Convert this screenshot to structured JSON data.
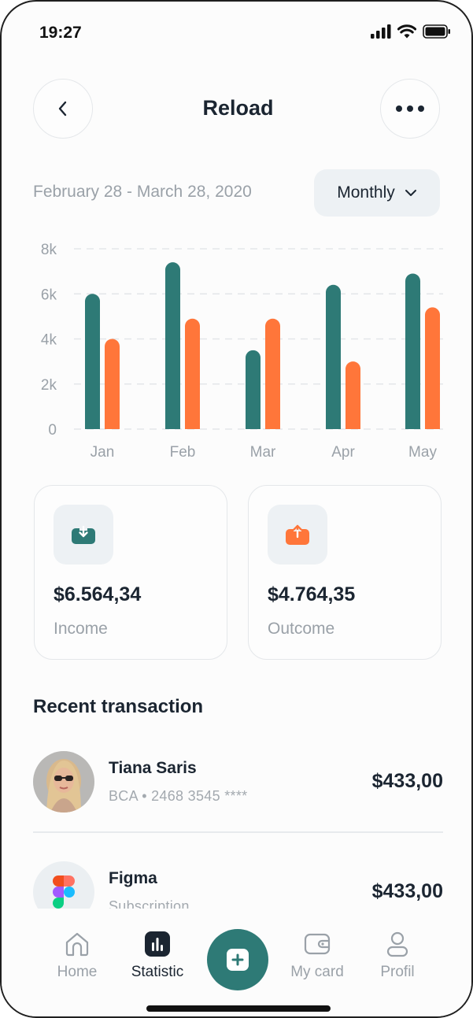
{
  "status": {
    "time": "19:27"
  },
  "header": {
    "title": "Reload"
  },
  "filters": {
    "date_range": "February 28 - March 28, 2020",
    "period": "Monthly"
  },
  "chart_data": {
    "type": "bar",
    "categories": [
      "Jan",
      "Feb",
      "Mar",
      "Apr",
      "May"
    ],
    "series": [
      {
        "values": [
          6000,
          7400,
          3500,
          6400,
          6900
        ],
        "color": "#2e7a76"
      },
      {
        "values": [
          4000,
          4900,
          4900,
          3000,
          5400
        ],
        "color": "#ff763a"
      }
    ],
    "ylim": [
      0,
      8000
    ],
    "yticks": [
      "0",
      "2k",
      "4k",
      "6k",
      "8k"
    ],
    "grid": true
  },
  "cards": {
    "income": {
      "amount": "$6.564,34",
      "label": "Income",
      "icon": "download-tray-icon",
      "color": "#2e7a76"
    },
    "outcome": {
      "amount": "$4.764,35",
      "label": "Outcome",
      "icon": "upload-tray-icon",
      "color": "#ff763a"
    }
  },
  "recent": {
    "title": "Recent transaction",
    "items": [
      {
        "name": "Tiana Saris",
        "sub": "BCA • 2468 3545 ****",
        "amount": "$433,00"
      },
      {
        "name": "Figma",
        "sub": "Subscription",
        "amount": "$433,00"
      }
    ]
  },
  "nav": {
    "home": "Home",
    "statistic": "Statistic",
    "card": "My card",
    "profile": "Profil",
    "active": "statistic"
  }
}
